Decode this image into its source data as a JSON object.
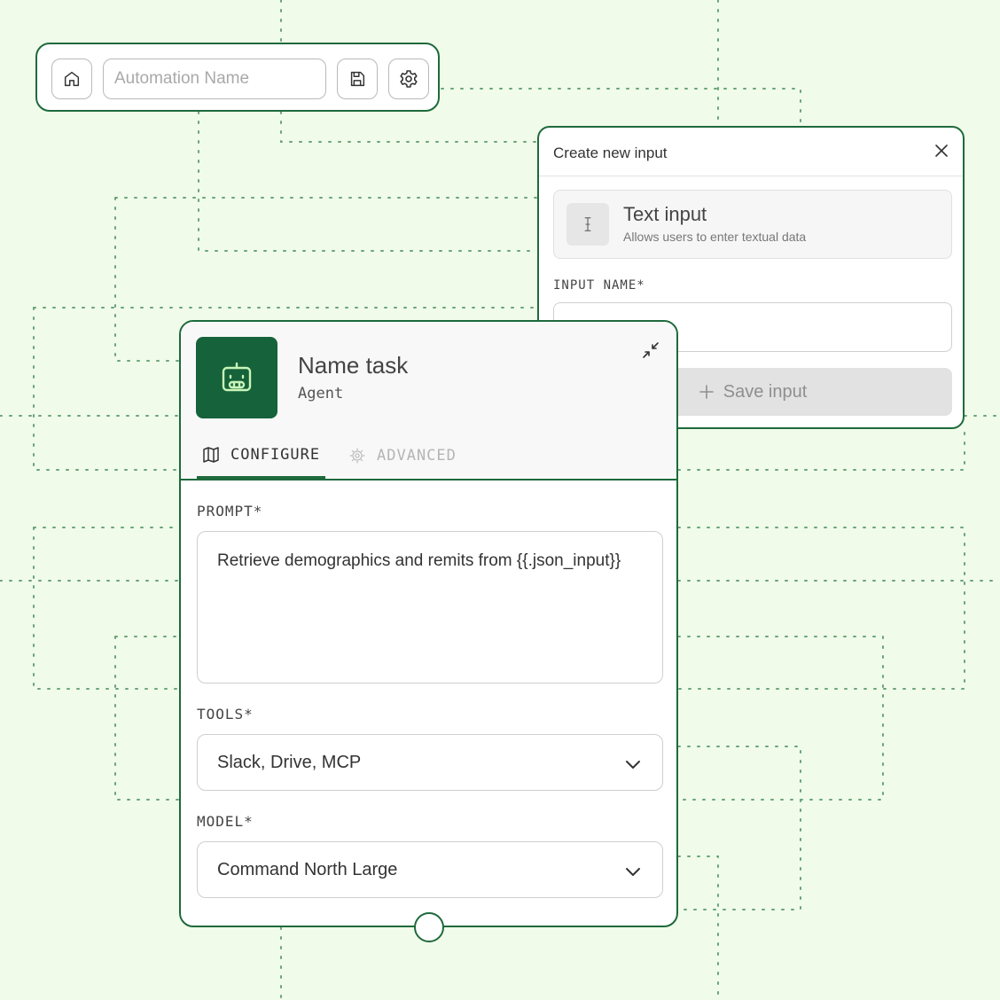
{
  "toolbar": {
    "name_placeholder": "Automation Name",
    "name_value": "",
    "icons": [
      "home-icon",
      "save-icon",
      "gear-icon"
    ]
  },
  "input_panel": {
    "title": "Create new input",
    "type_title": "Text input",
    "type_subtitle": "Allows users to enter textual data",
    "name_label": "INPUT NAME*",
    "name_value": "",
    "save_label": "Save input"
  },
  "task_card": {
    "title": "Name task",
    "subtitle": "Agent",
    "tabs": [
      {
        "label": "CONFIGURE",
        "active": true
      },
      {
        "label": "ADVANCED",
        "active": false
      }
    ],
    "prompt_label": "PROMPT*",
    "prompt_value": "Retrieve demographics and remits from {{.json_input}}",
    "tools_label": "TOOLS*",
    "tools_value": "Slack, Drive, MCP",
    "model_label": "MODEL*",
    "model_value": "Command North Large"
  },
  "colors": {
    "background": "#f0fbe9",
    "accent": "#1e6a3c",
    "avatar_bg": "#16623a",
    "dotted_lines": "#6aa47a"
  }
}
